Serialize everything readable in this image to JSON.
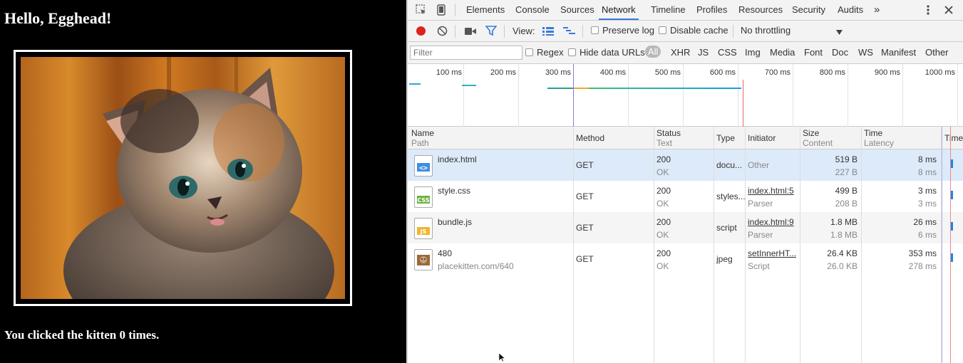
{
  "app": {
    "heading": "Hello, Egghead!",
    "footer_text": "You clicked the kitten 0 times."
  },
  "devtools": {
    "tabs": [
      "Elements",
      "Console",
      "Sources",
      "Network",
      "Timeline",
      "Profiles",
      "Resources",
      "Security",
      "Audits"
    ],
    "active_tab": "Network",
    "more_tabs": "»",
    "toolbar": {
      "view_label": "View:",
      "preserve_log": "Preserve log",
      "disable_cache": "Disable cache",
      "throttling": "No throttling"
    },
    "filter": {
      "placeholder": "Filter",
      "regex": "Regex",
      "hide_data_urls": "Hide data URLs",
      "types": [
        "All",
        "XHR",
        "JS",
        "CSS",
        "Img",
        "Media",
        "Font",
        "Doc",
        "WS",
        "Manifest",
        "Other"
      ]
    },
    "overview_ticks": [
      "100 ms",
      "200 ms",
      "300 ms",
      "400 ms",
      "500 ms",
      "600 ms",
      "700 ms",
      "800 ms",
      "900 ms",
      "1000 ms"
    ],
    "columns": {
      "name": "Name",
      "name_sub": "Path",
      "method": "Method",
      "status": "Status",
      "status_sub": "Text",
      "type": "Type",
      "initiator": "Initiator",
      "size": "Size",
      "size_sub": "Content",
      "time": "Time",
      "time_sub": "Latency",
      "timeline": "Timel"
    },
    "requests": [
      {
        "icon": "html-file-icon",
        "icon_label": "<>",
        "name": "index.html",
        "path": "",
        "method": "GET",
        "status": "200",
        "status_text": "OK",
        "type": "docu...",
        "initiator": "Other",
        "initiator_sub": "",
        "size": "519 B",
        "content": "227 B",
        "time": "8 ms",
        "latency": "8 ms"
      },
      {
        "icon": "css-file-icon",
        "icon_label": "CSS",
        "name": "style.css",
        "path": "",
        "method": "GET",
        "status": "200",
        "status_text": "OK",
        "type": "styles...",
        "initiator": "index.html:5",
        "initiator_sub": "Parser",
        "size": "499 B",
        "content": "208 B",
        "time": "3 ms",
        "latency": "3 ms"
      },
      {
        "icon": "js-file-icon",
        "icon_label": "JS",
        "name": "bundle.js",
        "path": "",
        "method": "GET",
        "status": "200",
        "status_text": "OK",
        "type": "script",
        "initiator": "index.html:9",
        "initiator_sub": "Parser",
        "size": "1.8 MB",
        "content": "1.8 MB",
        "time": "26 ms",
        "latency": "6 ms"
      },
      {
        "icon": "image-file-icon",
        "icon_label": "",
        "name": "480",
        "path": "placekitten.com/640",
        "method": "GET",
        "status": "200",
        "status_text": "OK",
        "type": "jpeg",
        "initiator": "setInnerHT...",
        "initiator_sub": "Script",
        "size": "26.4 KB",
        "content": "26.0 KB",
        "time": "353 ms",
        "latency": "278 ms"
      }
    ]
  },
  "colors": {
    "record": "#e0201b",
    "accent": "#3879d9",
    "selected_row": "#ddeaf9"
  }
}
